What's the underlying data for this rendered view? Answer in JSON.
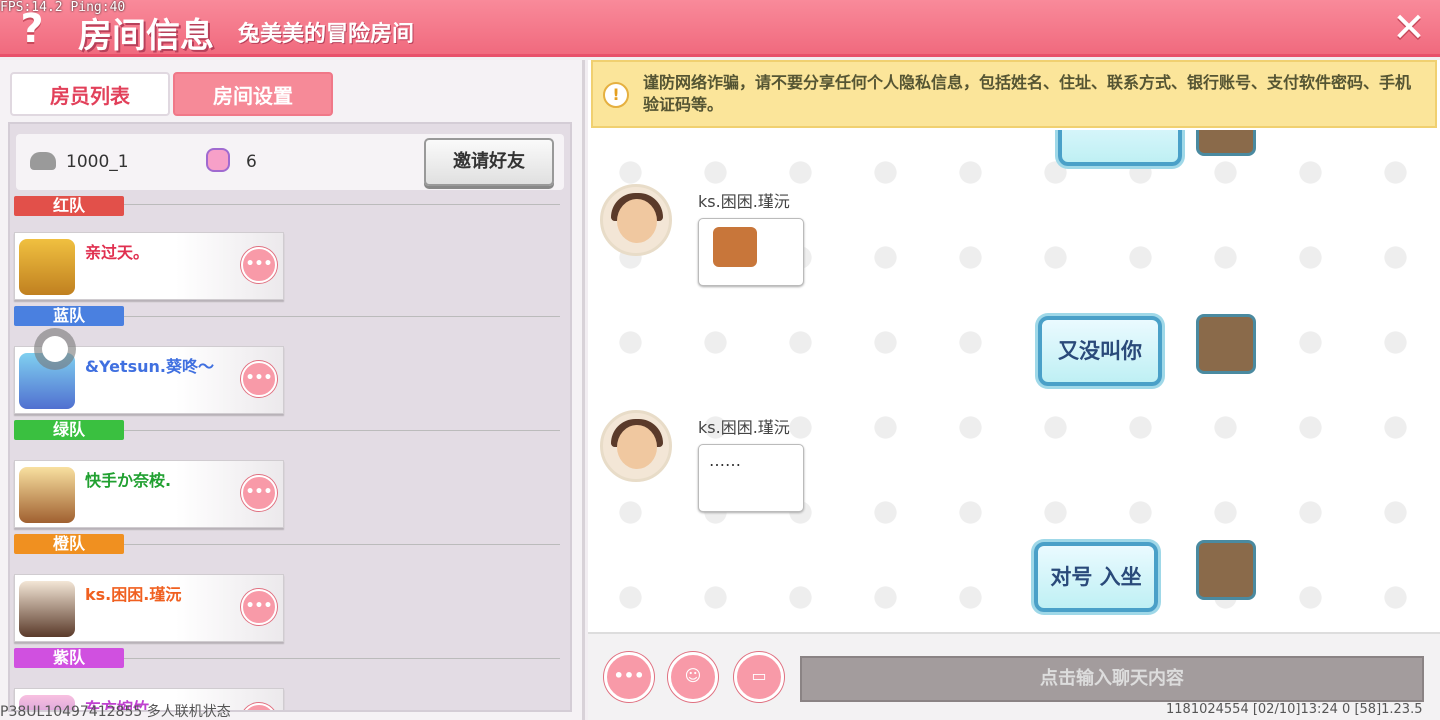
{
  "overlay": {
    "fps": "FPS:14.2  Ping:40"
  },
  "header": {
    "help": "?",
    "title": "房间信息",
    "subtitle": "兔美美的冒险房间",
    "close": "✕"
  },
  "tabs": {
    "members": "房员列表",
    "settings": "房间设置"
  },
  "room": {
    "id": "1000_1",
    "count": "6",
    "invite": "邀请好友"
  },
  "teams": [
    {
      "label": "红队",
      "color": "#e2504a"
    },
    {
      "label": "蓝队",
      "color": "#4a80e0"
    },
    {
      "label": "绿队",
      "color": "#3ac040"
    },
    {
      "label": "橙队",
      "color": "#f09020"
    },
    {
      "label": "紫队",
      "color": "#d050e0"
    }
  ],
  "members": [
    {
      "name": "亲过天。",
      "color": "#e03050",
      "more": "•••"
    },
    {
      "name": "&Yetsun.葵咚～",
      "color": "#4070e0",
      "more": "•••"
    },
    {
      "name": "快手か奈桉.",
      "color": "#20a030",
      "more": "•••"
    },
    {
      "name": "ks.困困.瑾沅",
      "color": "#f06020",
      "more": "•••"
    },
    {
      "name": "东方婉竹",
      "color": "#c040d0",
      "more": "•••"
    }
  ],
  "warning": {
    "icon": "!",
    "text": "谨防网络诈骗，请不要分享任何个人隐私信息，包括姓名、住址、联系方式、银行账号、支付软件密码、手机验证码等。"
  },
  "chat": {
    "messages": [
      {
        "user": "ks.困困.瑾沅",
        "side": "left"
      },
      {
        "text": "又没叫你",
        "side": "right"
      },
      {
        "user": "ks.困困.瑾沅",
        "text": "……",
        "side": "left"
      },
      {
        "text": "对号 入坐",
        "side": "right"
      }
    ]
  },
  "bottom": {
    "more": "•••",
    "emoji": "☺",
    "quick": "▭",
    "placeholder": "点击输入聊天内容"
  },
  "footer": {
    "left": "P38UL10497412855 多人联机状态",
    "right": "1181024554    [02/10]13:24 0    [58]1.23.5"
  }
}
